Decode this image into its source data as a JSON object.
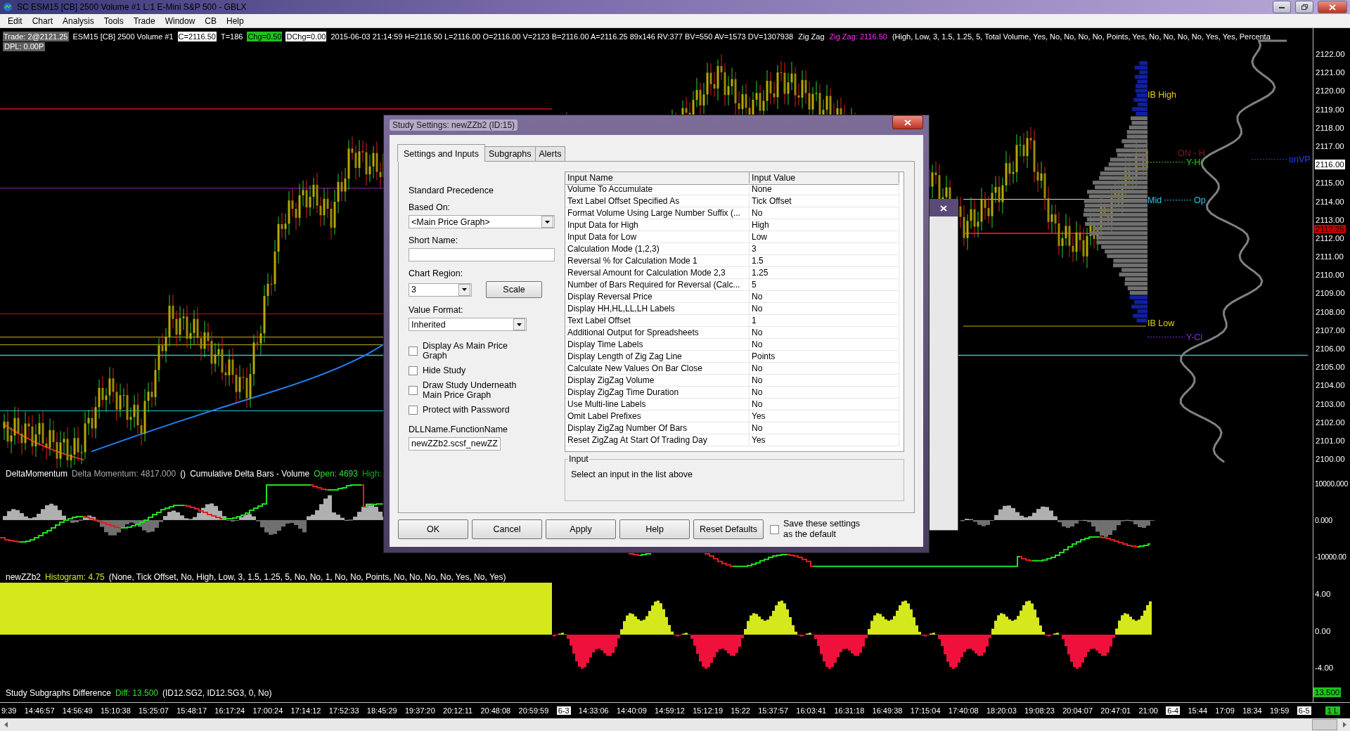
{
  "title_bar": {
    "title": "SC ESM15 [CB]  2500 Volume  #1  L:1  E-Mini S&P 500 - GBLX"
  },
  "menu": [
    "Edit",
    "Chart",
    "Analysis",
    "Tools",
    "Trade",
    "Window",
    "CB",
    "Help"
  ],
  "chart": {
    "header": [
      {
        "text": "Trade: 2@2121.25",
        "kind": "grey"
      },
      {
        "text": "ESM15 [CB]  2500 Volume  #1",
        "kind": "plain"
      },
      {
        "text": "C=2116.50",
        "kind": "white"
      },
      {
        "text": "T=186",
        "kind": "plain"
      },
      {
        "text": "Chg=0.50",
        "kind": "green"
      },
      {
        "text": "DChg=0.00",
        "kind": "white"
      },
      {
        "text": "2015-06-03 21:14:59 H=2116.50 L=2116.00 O=2116.00 V=2123 B=2116.00 A=2116.25 89x146 RV:377 BV=550 AV=1573 DV=1307938",
        "kind": "plain"
      },
      {
        "text": "Zig Zag",
        "kind": "plain"
      },
      {
        "text": "Zig Zag: 2116.50",
        "kind": "magenta"
      },
      {
        "text": "(High, Low, 3, 1.5, 1.25, 5, Total Volume, Yes, No, No, No, No, Points, Yes, No, No, No, No, Yes, Yes, Percenta",
        "kind": "plain"
      }
    ],
    "subheader": "DPL: 0.00P",
    "level_labels": [
      {
        "text": "IB High",
        "color": "#e8d000"
      },
      {
        "text": "ON - H",
        "color": "#8a1a1a"
      },
      {
        "text": "Y-Hi",
        "color": "#20d020"
      },
      {
        "text": "Mid",
        "color": "#30c8e8"
      },
      {
        "text": "Op",
        "color": "#30c8e8"
      },
      {
        "text": "IB Low",
        "color": "#e8d000"
      },
      {
        "text": "Y-Cl",
        "color": "#8030e0"
      },
      {
        "text": "onVP",
        "color": "#2040ff"
      }
    ],
    "price_axis": [
      {
        "text": "2122.00",
        "kind": "tick"
      },
      {
        "text": "2121.00",
        "kind": "tick"
      },
      {
        "text": "2120.00",
        "kind": "tick"
      },
      {
        "text": "2119.00",
        "kind": "tick"
      },
      {
        "text": "2118.00",
        "kind": "tick"
      },
      {
        "text": "2117.00",
        "kind": "tick"
      },
      {
        "text": "2116.00",
        "kind": "current"
      },
      {
        "text": "2115.00",
        "kind": "tick"
      },
      {
        "text": "2114.00",
        "kind": "tick"
      },
      {
        "text": "2113.00",
        "kind": "tick"
      },
      {
        "text": "2112.00",
        "kind": "tick",
        "marker": "2112.25"
      },
      {
        "text": "2111.00",
        "kind": "tick"
      },
      {
        "text": "2110.00",
        "kind": "tick"
      },
      {
        "text": "2109.00",
        "kind": "tick"
      },
      {
        "text": "2108.00",
        "kind": "tick"
      },
      {
        "text": "2107.00",
        "kind": "tick"
      },
      {
        "text": "2106.00",
        "kind": "tick"
      },
      {
        "text": "2105.00",
        "kind": "tick"
      },
      {
        "text": "2104.00",
        "kind": "tick"
      },
      {
        "text": "2103.00",
        "kind": "tick"
      },
      {
        "text": "2102.00",
        "kind": "tick"
      },
      {
        "text": "2101.00",
        "kind": "tick"
      },
      {
        "text": "2100.00",
        "kind": "tick"
      }
    ],
    "delta_panel": {
      "labels": [
        {
          "text": "DeltaMomentum",
          "kind": "white"
        },
        {
          "text": "Delta Momentum: 4817.000",
          "kind": "grey"
        },
        {
          "text": "()",
          "kind": "white"
        },
        {
          "text": "Cumulative Delta Bars - Volume",
          "kind": "white"
        },
        {
          "text": "Open: 4693",
          "kind": "green"
        },
        {
          "text": "High:",
          "kind": "darkgreen"
        }
      ],
      "axis": [
        "10000.000",
        "0.000",
        "-10000.00"
      ]
    },
    "histogram_panel": {
      "labels": [
        {
          "text": "newZZb2",
          "kind": "white"
        },
        {
          "text": "Histogram: 4.75",
          "kind": "yellow"
        },
        {
          "text": "(None, Tick Offset, No, High, Low, 3, 1.5, 1.25, 5, No, No, 1, No, No, Points, No, No, No, No, Yes, No, Yes)",
          "kind": "white"
        }
      ],
      "axis": [
        "4.00",
        "0.00",
        "-4.00"
      ]
    },
    "diff_panel": {
      "labels": [
        {
          "text": "Study Subgraphs Difference",
          "kind": "white"
        },
        {
          "text": "Diff: 13.500",
          "kind": "green"
        },
        {
          "text": "(ID12.SG2, ID12.SG3, 0, No)",
          "kind": "white"
        }
      ],
      "reading": "13.500"
    },
    "time_axis": [
      {
        "text": "9:39",
        "kind": "time"
      },
      {
        "text": "14:46:57",
        "kind": "time"
      },
      {
        "text": "14:56:49",
        "kind": "time"
      },
      {
        "text": "15:10:38",
        "kind": "time"
      },
      {
        "text": "15:25:07",
        "kind": "time"
      },
      {
        "text": "15:48:17",
        "kind": "time"
      },
      {
        "text": "16:17:24",
        "kind": "time"
      },
      {
        "text": "17:00:24",
        "kind": "time"
      },
      {
        "text": "17:14:12",
        "kind": "time"
      },
      {
        "text": "17:52:33",
        "kind": "time"
      },
      {
        "text": "18:45:29",
        "kind": "time"
      },
      {
        "text": "19:37:20",
        "kind": "time"
      },
      {
        "text": "20:12:11",
        "kind": "time"
      },
      {
        "text": "20:48:08",
        "kind": "time"
      },
      {
        "text": "20:59:59",
        "kind": "time"
      },
      {
        "text": "6-3",
        "kind": "date"
      },
      {
        "text": "14:33:06",
        "kind": "time"
      },
      {
        "text": "14:40:09",
        "kind": "time"
      },
      {
        "text": "14:59:12",
        "kind": "time"
      },
      {
        "text": "15:12:19",
        "kind": "time"
      },
      {
        "text": "15:22",
        "kind": "time"
      },
      {
        "text": "15:37:57",
        "kind": "time"
      },
      {
        "text": "16:03:41",
        "kind": "time"
      },
      {
        "text": "16:31:18",
        "kind": "time"
      },
      {
        "text": "16:49:38",
        "kind": "time"
      },
      {
        "text": "17:15:04",
        "kind": "time"
      },
      {
        "text": "17:40:08",
        "kind": "time"
      },
      {
        "text": "18:20:03",
        "kind": "time"
      },
      {
        "text": "19:08:23",
        "kind": "time"
      },
      {
        "text": "20:04:07",
        "kind": "time"
      },
      {
        "text": "20:47:01",
        "kind": "time"
      },
      {
        "text": "21:00",
        "kind": "time"
      },
      {
        "text": "6-4",
        "kind": "date"
      },
      {
        "text": "15:44",
        "kind": "time"
      },
      {
        "text": "17:09",
        "kind": "time"
      },
      {
        "text": "18:34",
        "kind": "time"
      },
      {
        "text": "19:59",
        "kind": "time"
      },
      {
        "text": "6-5",
        "kind": "date"
      }
    ],
    "status": "1 L"
  },
  "dialog": {
    "title": "Study Settings: newZZb2 (ID:15)",
    "tabs": [
      {
        "label": "Settings and Inputs",
        "selected": true
      },
      {
        "label": "Subgraphs",
        "selected": false
      },
      {
        "label": "Alerts",
        "selected": false
      }
    ],
    "precedence": "Standard Precedence",
    "based_on": {
      "label": "Based On:",
      "value": "<Main Price Graph>"
    },
    "short_name": {
      "label": "Short Name:"
    },
    "chart_region": {
      "label": "Chart Region:",
      "value": "3",
      "button": "Scale"
    },
    "value_format": {
      "label": "Value Format:",
      "value": "Inherited"
    },
    "options": [
      {
        "label": "Display As Main Price Graph",
        "checked": false
      },
      {
        "label": "Hide Study",
        "checked": false
      },
      {
        "label": "Draw Study Underneath Main Price Graph",
        "checked": false
      },
      {
        "label": "Protect with Password",
        "checked": false
      }
    ],
    "dll": {
      "label": "DLLName.FunctionName",
      "value": "newZZb2.scsf_newZZ"
    },
    "table": {
      "columns": [
        "Input Name",
        "Input Value"
      ],
      "rows": [
        [
          "Volume To Accumulate",
          "None"
        ],
        [
          "Text Label Offset Specified As",
          "Tick Offset"
        ],
        [
          "Format Volume Using Large Number Suffix (...",
          "No"
        ],
        [
          "Input Data for High",
          "High"
        ],
        [
          "Input Data for Low",
          "Low"
        ],
        [
          "Calculation Mode (1,2,3)",
          "3"
        ],
        [
          "Reversal % for Calculation Mode 1",
          "1.5"
        ],
        [
          "Reversal Amount for Calculation Mode 2,3",
          "1.25"
        ],
        [
          "Number of Bars Required for Reversal (Calc...",
          "5"
        ],
        [
          "Display Reversal Price",
          "No"
        ],
        [
          "Display HH,HL,LL,LH Labels",
          "No"
        ],
        [
          "Text Label Offset",
          "1"
        ],
        [
          "Additional Output for Spreadsheets",
          "No"
        ],
        [
          "Display Time Labels",
          "No"
        ],
        [
          "Display Length of Zig Zag Line",
          "Points"
        ],
        [
          "Calculate New Values On Bar Close",
          "No"
        ],
        [
          "Display ZigZag Volume",
          "No"
        ],
        [
          "Display ZigZag Time Duration",
          "No"
        ],
        [
          "Use Multi-line Labels",
          "No"
        ],
        [
          "Omit Label Prefixes",
          "Yes"
        ],
        [
          "Display ZigZag Number Of Bars",
          "No"
        ],
        [
          "Reset ZigZag At Start Of Trading Day",
          "Yes"
        ]
      ]
    },
    "input_group": {
      "title": "Input",
      "text": "Select an input in the list above"
    },
    "buttons": [
      "OK",
      "Cancel",
      "Apply",
      "Help",
      "Reset Defaults"
    ],
    "save_default": {
      "label": "Save these settings as the default",
      "checked": false
    }
  }
}
